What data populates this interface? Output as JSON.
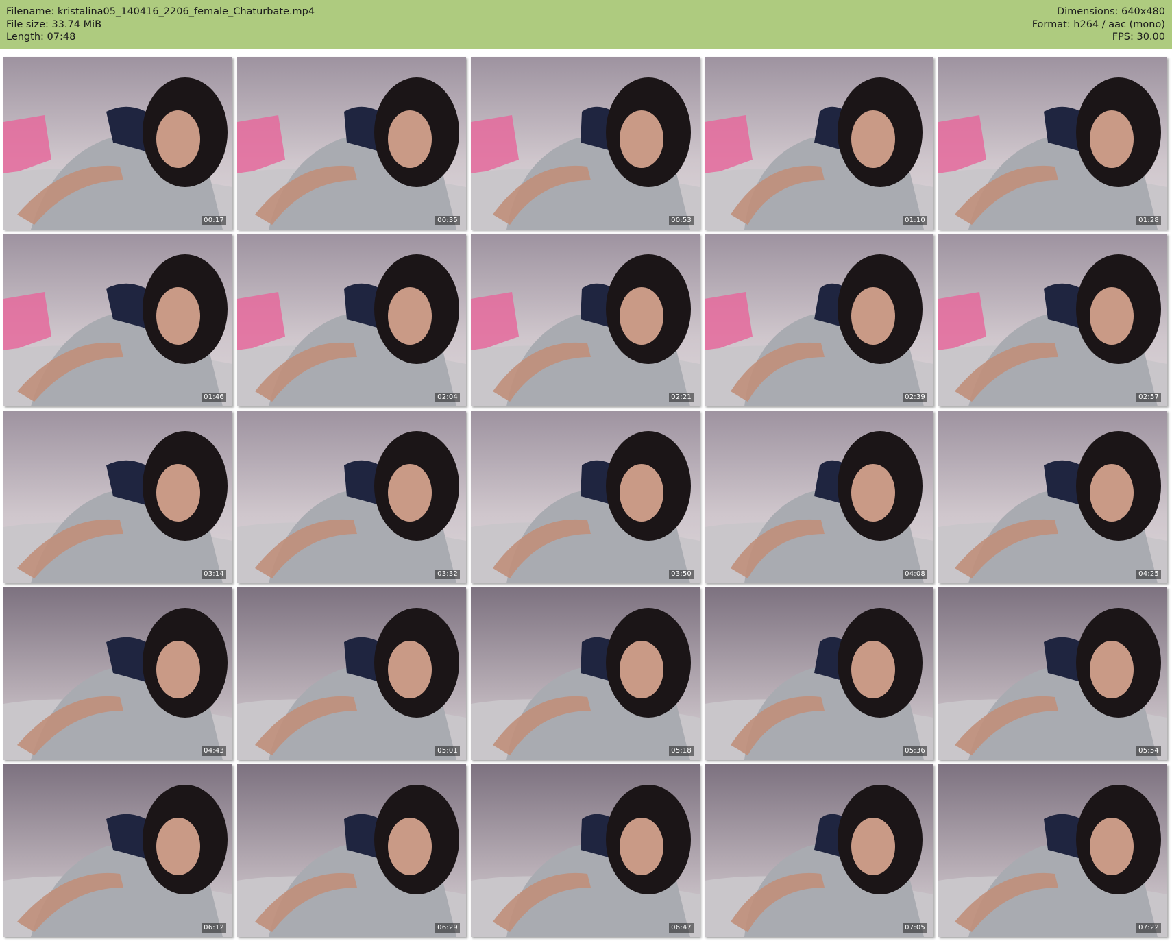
{
  "header": {
    "filename_label": "Filename: kristalina05_140416_2206_female_Chaturbate.mp4",
    "filesize_label": "File size: 33.74 MiB",
    "length_label": "Length: 07:48",
    "dimensions_label": "Dimensions: 640x480",
    "format_label": "Format: h264 / aac (mono)",
    "fps_label": "FPS: 30.00",
    "background_color": "#aecb7f"
  },
  "thumbnails": [
    {
      "time": "00:17"
    },
    {
      "time": "00:35"
    },
    {
      "time": "00:53"
    },
    {
      "time": "01:10"
    },
    {
      "time": "01:28"
    },
    {
      "time": "01:46"
    },
    {
      "time": "02:04"
    },
    {
      "time": "02:21"
    },
    {
      "time": "02:39"
    },
    {
      "time": "02:57"
    },
    {
      "time": "03:14"
    },
    {
      "time": "03:32"
    },
    {
      "time": "03:50"
    },
    {
      "time": "04:08"
    },
    {
      "time": "04:25"
    },
    {
      "time": "04:43"
    },
    {
      "time": "05:01"
    },
    {
      "time": "05:18"
    },
    {
      "time": "05:36"
    },
    {
      "time": "05:54"
    },
    {
      "time": "06:12"
    },
    {
      "time": "06:29"
    },
    {
      "time": "06:47"
    },
    {
      "time": "07:05"
    },
    {
      "time": "07:22"
    }
  ]
}
